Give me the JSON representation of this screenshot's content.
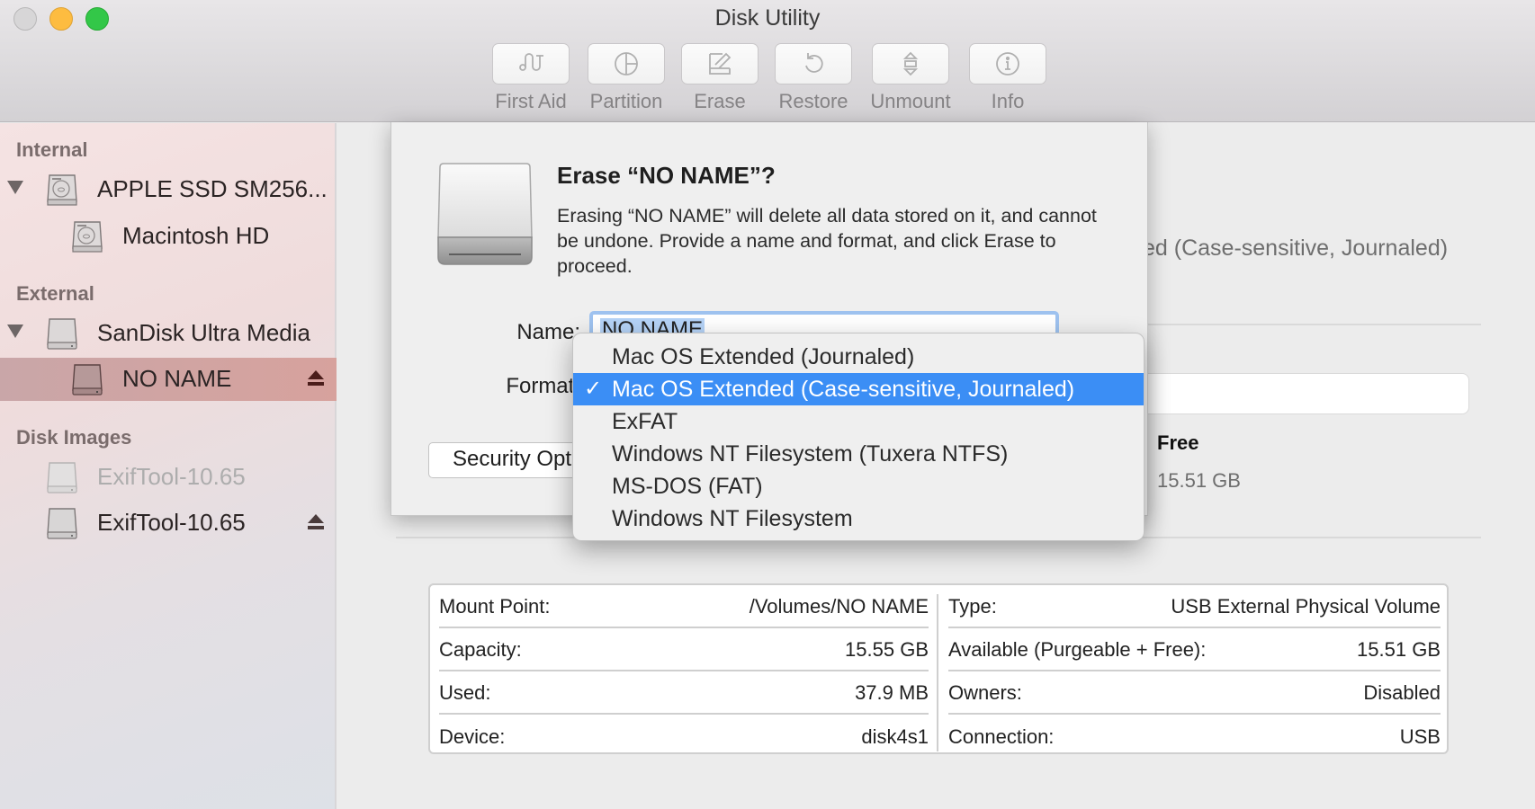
{
  "window": {
    "title": "Disk Utility",
    "controls": [
      "close",
      "minimize",
      "zoom"
    ]
  },
  "toolbar": {
    "buttons": [
      {
        "label": "First Aid",
        "icon": "stethoscope-icon"
      },
      {
        "label": "Partition",
        "icon": "pie-chart-icon"
      },
      {
        "label": "Erase",
        "icon": "eraser-icon"
      },
      {
        "label": "Restore",
        "icon": "restore-arrow-icon"
      },
      {
        "label": "Unmount",
        "icon": "unmount-icon"
      },
      {
        "label": "Info",
        "icon": "info-icon"
      }
    ]
  },
  "sidebar": {
    "sections": [
      {
        "header": "Internal",
        "items": [
          {
            "label": "APPLE SSD SM256...",
            "level": 0,
            "expanded": true,
            "icon": "internal-disk-icon"
          },
          {
            "label": "Macintosh HD",
            "level": 1,
            "icon": "internal-disk-icon"
          }
        ]
      },
      {
        "header": "External",
        "items": [
          {
            "label": "SanDisk Ultra Media",
            "level": 0,
            "expanded": true,
            "icon": "external-disk-icon"
          },
          {
            "label": "NO NAME",
            "level": 1,
            "selected": true,
            "ejectable": true,
            "icon": "external-disk-icon"
          }
        ]
      },
      {
        "header": "Disk Images",
        "items": [
          {
            "label": "ExifTool-10.65",
            "level": 0,
            "dimmed": true,
            "icon": "disk-image-icon"
          },
          {
            "label": "ExifTool-10.65",
            "level": 0,
            "ejectable": true,
            "icon": "disk-image-icon"
          }
        ]
      }
    ]
  },
  "main": {
    "format_text_partial": "ed (Case-sensitive, Journaled)",
    "free_label": "Free",
    "free_value": "15.51 GB",
    "info": {
      "left": [
        {
          "label": "Mount Point:",
          "value": "/Volumes/NO NAME"
        },
        {
          "label": "Capacity:",
          "value": "15.55 GB"
        },
        {
          "label": "Used:",
          "value": "37.9 MB"
        },
        {
          "label": "Device:",
          "value": "disk4s1"
        }
      ],
      "right": [
        {
          "label": "Type:",
          "value": "USB External Physical Volume"
        },
        {
          "label": "Available (Purgeable + Free):",
          "value": "15.51 GB"
        },
        {
          "label": "Owners:",
          "value": "Disabled"
        },
        {
          "label": "Connection:",
          "value": "USB"
        }
      ]
    }
  },
  "erase_sheet": {
    "title": "Erase “NO NAME”?",
    "message": "Erasing “NO NAME” will delete all data stored on it, and cannot be undone. Provide a name and format, and click Erase to proceed.",
    "name_label": "Name:",
    "name_value": "NO NAME",
    "format_label": "Format:",
    "security_button": "Security Options...",
    "format_menu": {
      "selected_index": 1,
      "options": [
        "Mac OS Extended (Journaled)",
        "Mac OS Extended (Case-sensitive, Journaled)",
        "ExFAT",
        "Windows NT Filesystem (Tuxera NTFS)",
        "MS-DOS (FAT)",
        "Windows NT Filesystem"
      ]
    }
  },
  "colors": {
    "menu_highlight": "#3b8ef5",
    "selection_row": "#d3a39f",
    "focus_ring": "#9ec2ef"
  }
}
